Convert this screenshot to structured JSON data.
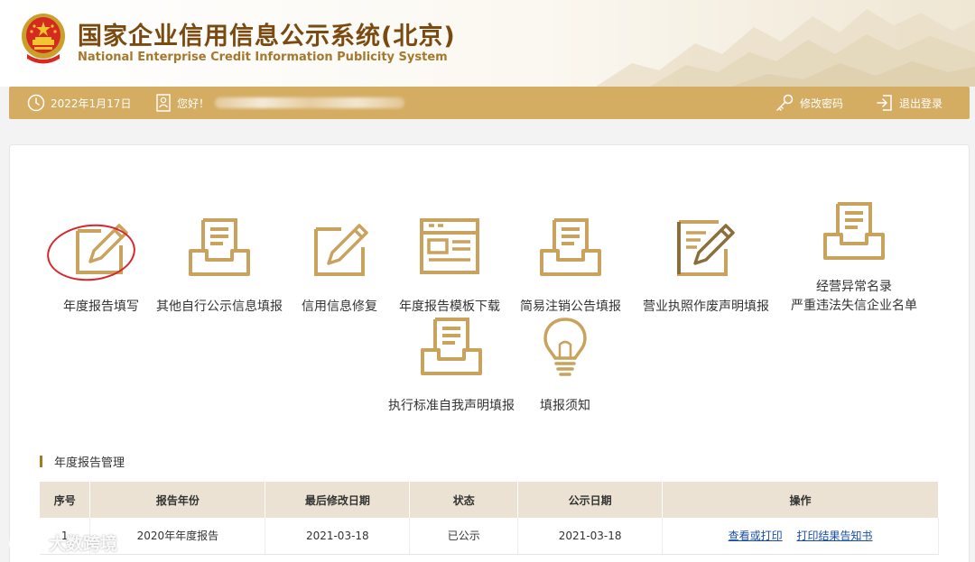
{
  "header": {
    "title": "国家企业信用信息公示系统(北京)",
    "subtitle": "National Enterprise Credit Information Publicity System"
  },
  "infobar": {
    "date": "2022年1月17日",
    "greeting": "您好！",
    "change_password": "修改密码",
    "logout": "退出登录"
  },
  "functions": [
    {
      "label": "年度报告填写",
      "icon": "pen-edit-icon"
    },
    {
      "label": "其他自行公示信息填报",
      "icon": "document-tray-icon"
    },
    {
      "label": "信用信息修复",
      "icon": "pen-edit-icon"
    },
    {
      "label": "年度报告模板下载",
      "icon": "template-icon"
    },
    {
      "label": "简易注销公告填报",
      "icon": "document-tray-icon"
    },
    {
      "label": "营业执照作废声明填报",
      "icon": "certificate-edit-icon"
    },
    {
      "label_line1": "经营异常名录",
      "label_line2": "严重违法失信企业名单",
      "icon": "document-tray-icon"
    },
    {
      "label": "执行标准自我声明填报",
      "icon": "document-tray-icon"
    },
    {
      "label": "填报须知",
      "icon": "lightbulb-icon"
    }
  ],
  "section": {
    "title": "年度报告管理"
  },
  "table": {
    "headers": [
      "序号",
      "报告年份",
      "最后修改日期",
      "状态",
      "公示日期",
      "操作"
    ],
    "rows": [
      {
        "index": "1",
        "year": "2020年年度报告",
        "modified": "2021-03-18",
        "status": "已公示",
        "publish_date": "2021-03-18",
        "action_view": "查看或打印",
        "action_print": "打印结果告知书"
      }
    ]
  },
  "watermark": {
    "text": "大数跨境"
  },
  "colors": {
    "gold": "#d4ad63",
    "icon_gold": "#c9a35d",
    "title_brown": "#7a4a10",
    "link_blue": "#1a4ea6",
    "highlight_red": "#d9262c"
  }
}
